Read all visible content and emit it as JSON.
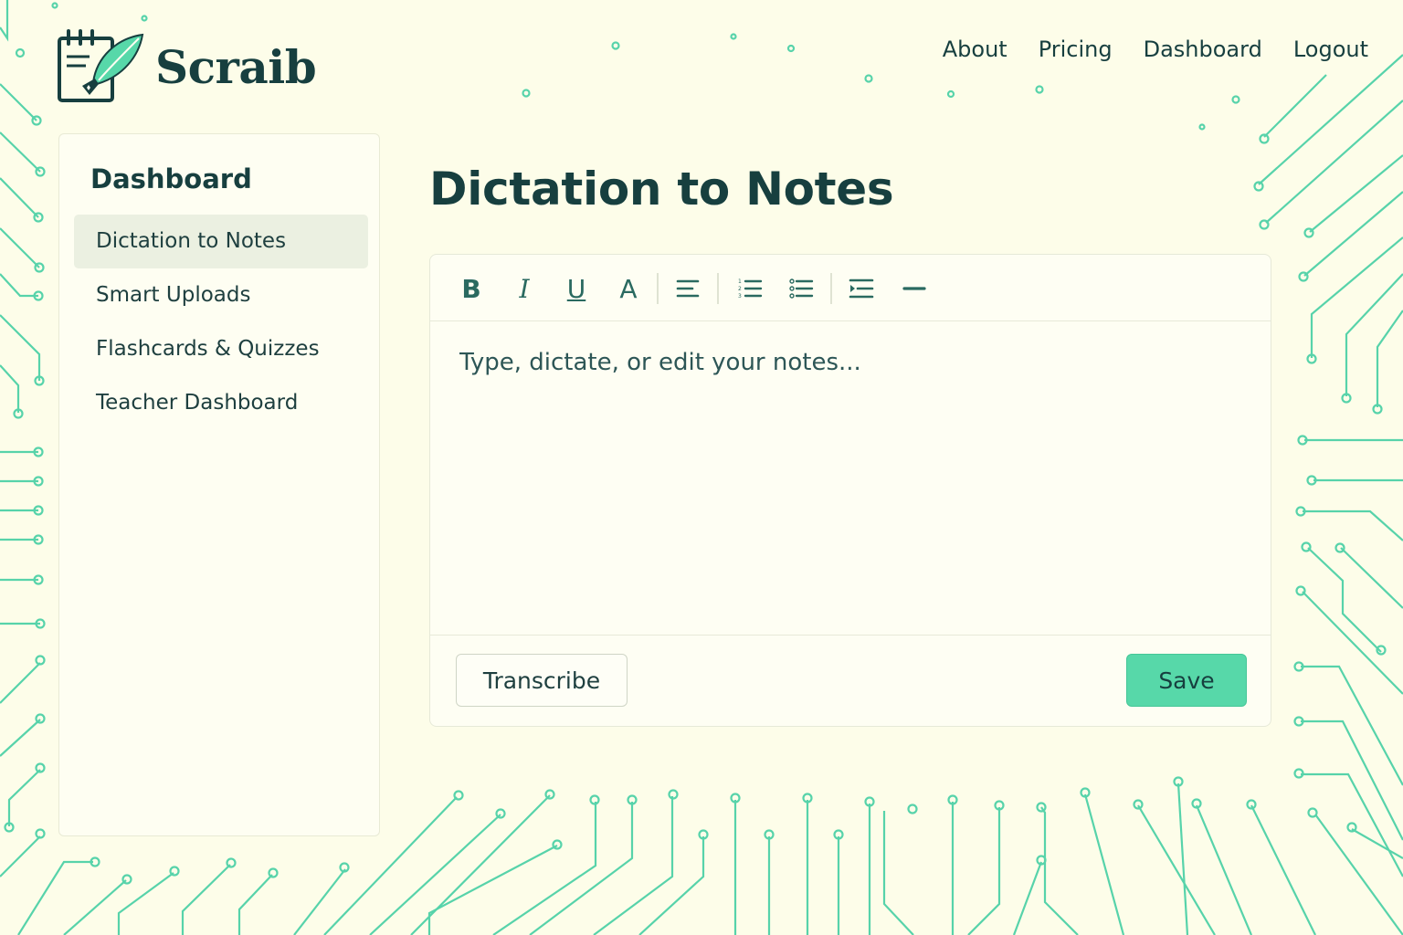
{
  "app": {
    "name": "Scraib",
    "logo_icon": "notepad-quill-icon"
  },
  "topnav": {
    "items": [
      "About",
      "Pricing",
      "Dashboard",
      "Logout"
    ]
  },
  "sidebar": {
    "title": "Dashboard",
    "items": [
      {
        "label": "Dictation to Notes",
        "active": true
      },
      {
        "label": "Smart Uploads"
      },
      {
        "label": "Flashcards & Quizzes"
      },
      {
        "label": "Teacher Dashboard"
      }
    ]
  },
  "main": {
    "title": "Dictation to Notes",
    "editor": {
      "toolbar": [
        {
          "label": "B",
          "icon": "bold-icon"
        },
        {
          "label": "I",
          "icon": "italic-icon"
        },
        {
          "label": "U",
          "icon": "underline-icon"
        },
        {
          "label": "A",
          "icon": "font-color-icon"
        },
        {
          "icon": "align-left-icon"
        },
        {
          "icon": "numbered-list-icon"
        },
        {
          "icon": "bulleted-list-icon"
        },
        {
          "icon": "indent-icon"
        },
        {
          "icon": "horizontal-rule-icon"
        }
      ],
      "placeholder": "Type, dictate, or edit your notes...",
      "value": ""
    },
    "actions": {
      "transcribe": "Transcribe",
      "save": "Save"
    }
  },
  "colors": {
    "background": "#fdfde9",
    "text": "#173f3f",
    "accent": "#57d8a9",
    "circuit": "#57d8a9"
  }
}
